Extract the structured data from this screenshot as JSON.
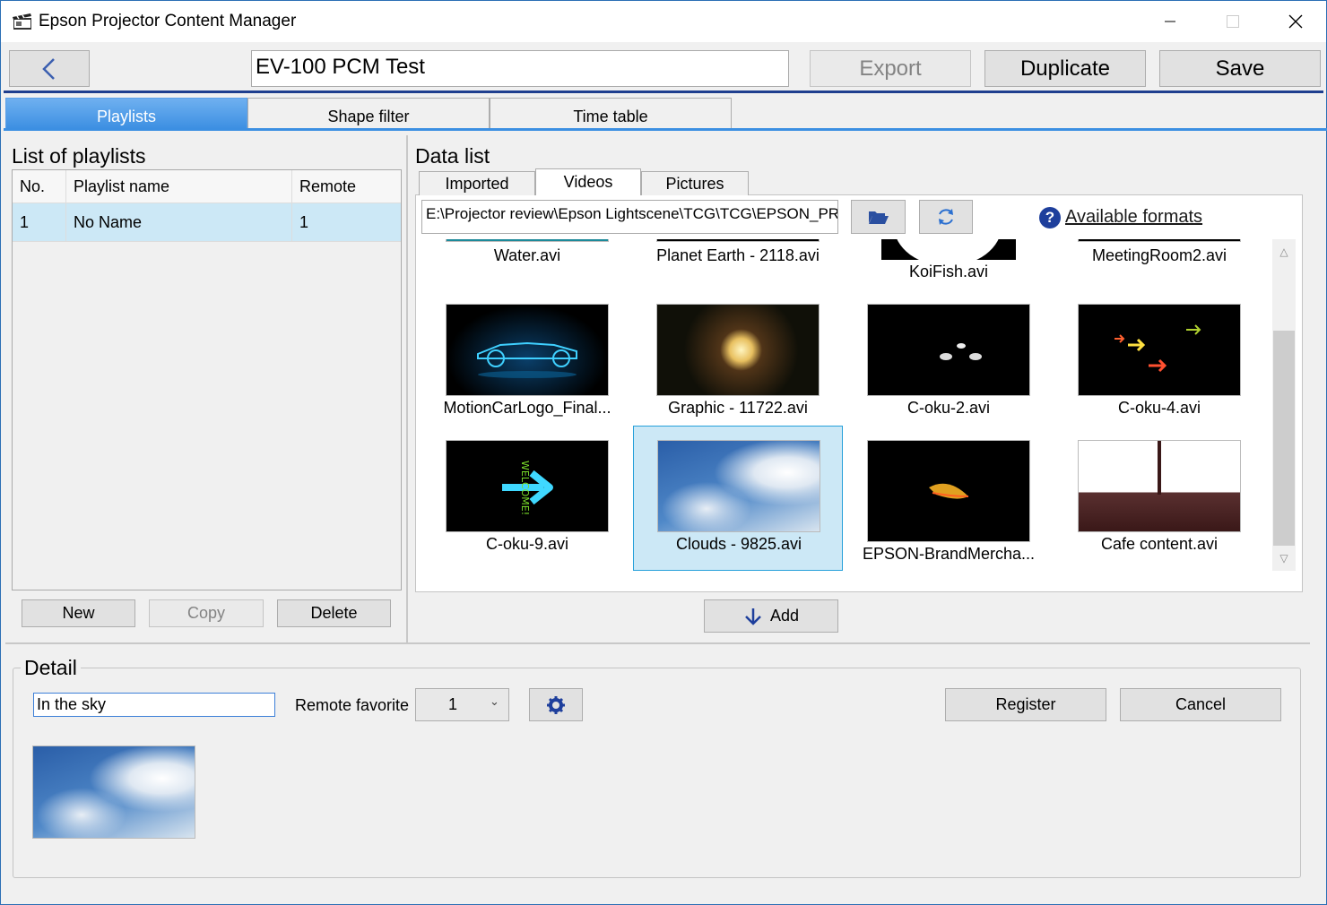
{
  "window": {
    "title": "Epson Projector Content Manager"
  },
  "toolbar": {
    "name_value": "EV-100 PCM Test",
    "export_label": "Export",
    "duplicate_label": "Duplicate",
    "save_label": "Save"
  },
  "tabs": [
    {
      "label": "Playlists",
      "active": true
    },
    {
      "label": "Shape filter",
      "active": false
    },
    {
      "label": "Time table",
      "active": false
    }
  ],
  "playlists": {
    "title": "List of playlists",
    "columns": [
      "No.",
      "Playlist name",
      "Remote"
    ],
    "rows": [
      {
        "no": "1",
        "name": "No Name",
        "remote": "1"
      }
    ],
    "buttons": {
      "new": "New",
      "copy": "Copy",
      "delete": "Delete"
    }
  },
  "data_list": {
    "title": "Data list",
    "tabs": [
      "Imported",
      "Videos",
      "Pictures"
    ],
    "active_tab": "Videos",
    "path": "E:\\Projector review\\Epson Lightscene\\TCG\\TCG\\EPSON_PR",
    "formats_link": "Available formats",
    "items": [
      {
        "label": "Water.avi"
      },
      {
        "label": "Planet Earth - 2118.avi"
      },
      {
        "label": "KoiFish.avi"
      },
      {
        "label": "MeetingRoom2.avi"
      },
      {
        "label": "MotionCarLogo_Final..."
      },
      {
        "label": "Graphic - 11722.avi"
      },
      {
        "label": "C-oku-2.avi"
      },
      {
        "label": "C-oku-4.avi"
      },
      {
        "label": "C-oku-9.avi",
        "thumb_text": "WELCOME!"
      },
      {
        "label": "Clouds - 9825.avi",
        "selected": true
      },
      {
        "label": "EPSON-BrandMercha..."
      },
      {
        "label": "Cafe content.avi"
      }
    ],
    "add_label": "Add"
  },
  "detail": {
    "title": "Detail",
    "name_value": "In the sky",
    "remote_favorite_label": "Remote favorite",
    "remote_favorite_value": "1",
    "register_label": "Register",
    "cancel_label": "Cancel"
  },
  "colors": {
    "accent": "#3c8fe2",
    "selection": "#cce8f6",
    "toolbar_line": "#1f3f8f"
  }
}
